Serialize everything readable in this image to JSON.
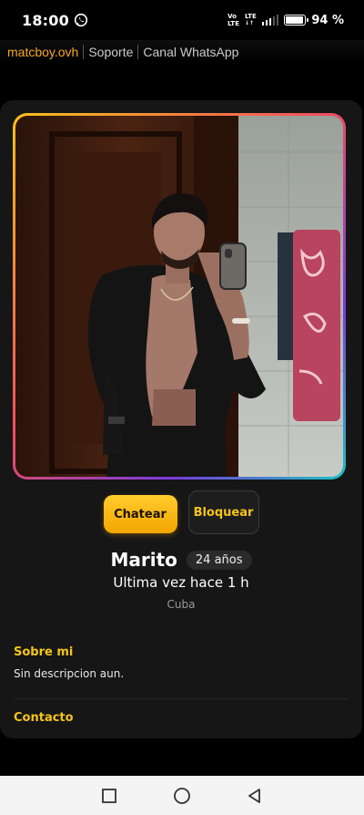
{
  "status_bar": {
    "time": "18:00",
    "network_top": "Vo",
    "network_bottom": "LTE",
    "network2_top": "LTE",
    "battery_percent": "94 %",
    "battery_level": 0.94,
    "whatsapp_icon": "whatsapp-icon"
  },
  "nav": {
    "brand": "matcboy.ovh",
    "support": "Soporte",
    "whatsapp_channel": "Canal WhatsApp"
  },
  "profile": {
    "photo_icon": "profile-photo",
    "chat_label": "Chatear",
    "block_label": "Bloquear",
    "name": "Marito",
    "age": "24 años",
    "last_seen": "Ultima vez hace 1 h",
    "location": "Cuba",
    "about_title": "Sobre mi",
    "about_text": "Sin descripcion aun.",
    "contact_title": "Contacto"
  },
  "colors": {
    "accent": "#f5c518",
    "brand": "#f5a623",
    "card_bg": "#161616"
  },
  "system_nav": {
    "recents": "square-icon",
    "home": "circle-icon",
    "back": "triangle-back-icon"
  }
}
